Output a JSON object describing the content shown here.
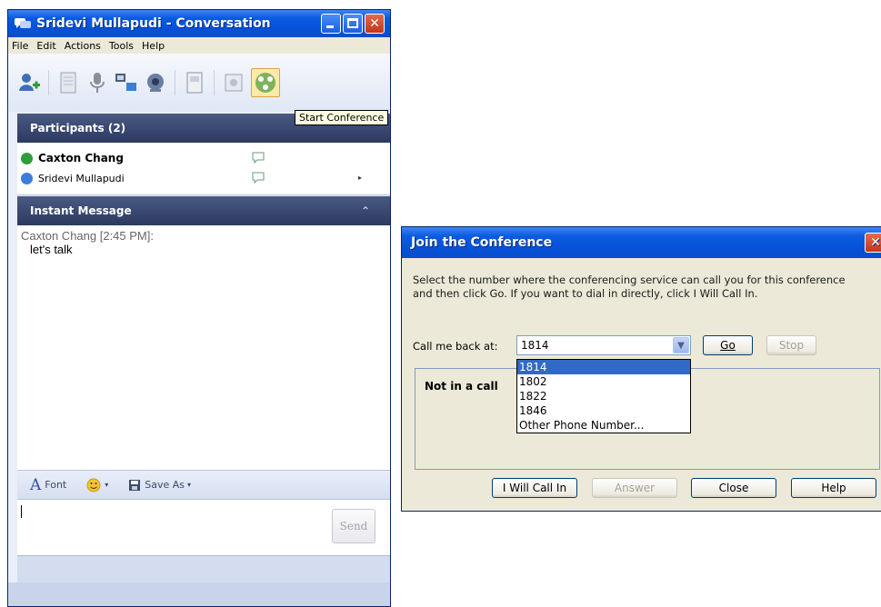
{
  "conversation": {
    "title": "Sridevi Mullapudi - Conversation",
    "menu": [
      "File",
      "Edit",
      "Actions",
      "Tools",
      "Help"
    ],
    "toolbar_icons": [
      "add-participant-icon",
      "share-file-icon",
      "audio-icon",
      "video-icon",
      "webcam-icon",
      "whiteboard-icon",
      "call-icon",
      "start-conference-icon"
    ],
    "tooltip": "Start Conference",
    "participants_header": "Participants (2)",
    "participants": [
      {
        "name": "Caxton Chang",
        "status_color": "#2e9d3a"
      },
      {
        "name": "Sridevi Mullapudi",
        "status_color": "#3b7dd8"
      }
    ],
    "im_header": "Instant Message",
    "messages": [
      {
        "sender": "Caxton Chang [2:45 PM]:",
        "text": "let's talk"
      }
    ],
    "format_bar": {
      "font": "Font",
      "save_as": "Save As"
    },
    "send_label": "Send"
  },
  "join_dialog": {
    "title": "Join the Conference",
    "instruction_line1": "Select the number where the conferencing service can call you for this conference",
    "instruction_line2": "and then click Go. If you want to dial in directly, click I Will Call In.",
    "callback_label": "Call me back at:",
    "callback_value": "1814",
    "go_label": "Go",
    "stop_label": "Stop",
    "status": "Not in a call",
    "dropdown_options": [
      "1814",
      "1802",
      "1822",
      "1846",
      "Other Phone Number..."
    ],
    "buttons": {
      "will_call_in": "I Will Call In",
      "answer": "Answer",
      "close": "Close",
      "help": "Help"
    }
  },
  "colors": {
    "xp_title_blue": "#0a5ae0",
    "section_header": "#2c3a62",
    "selection_blue": "#316ac5"
  }
}
